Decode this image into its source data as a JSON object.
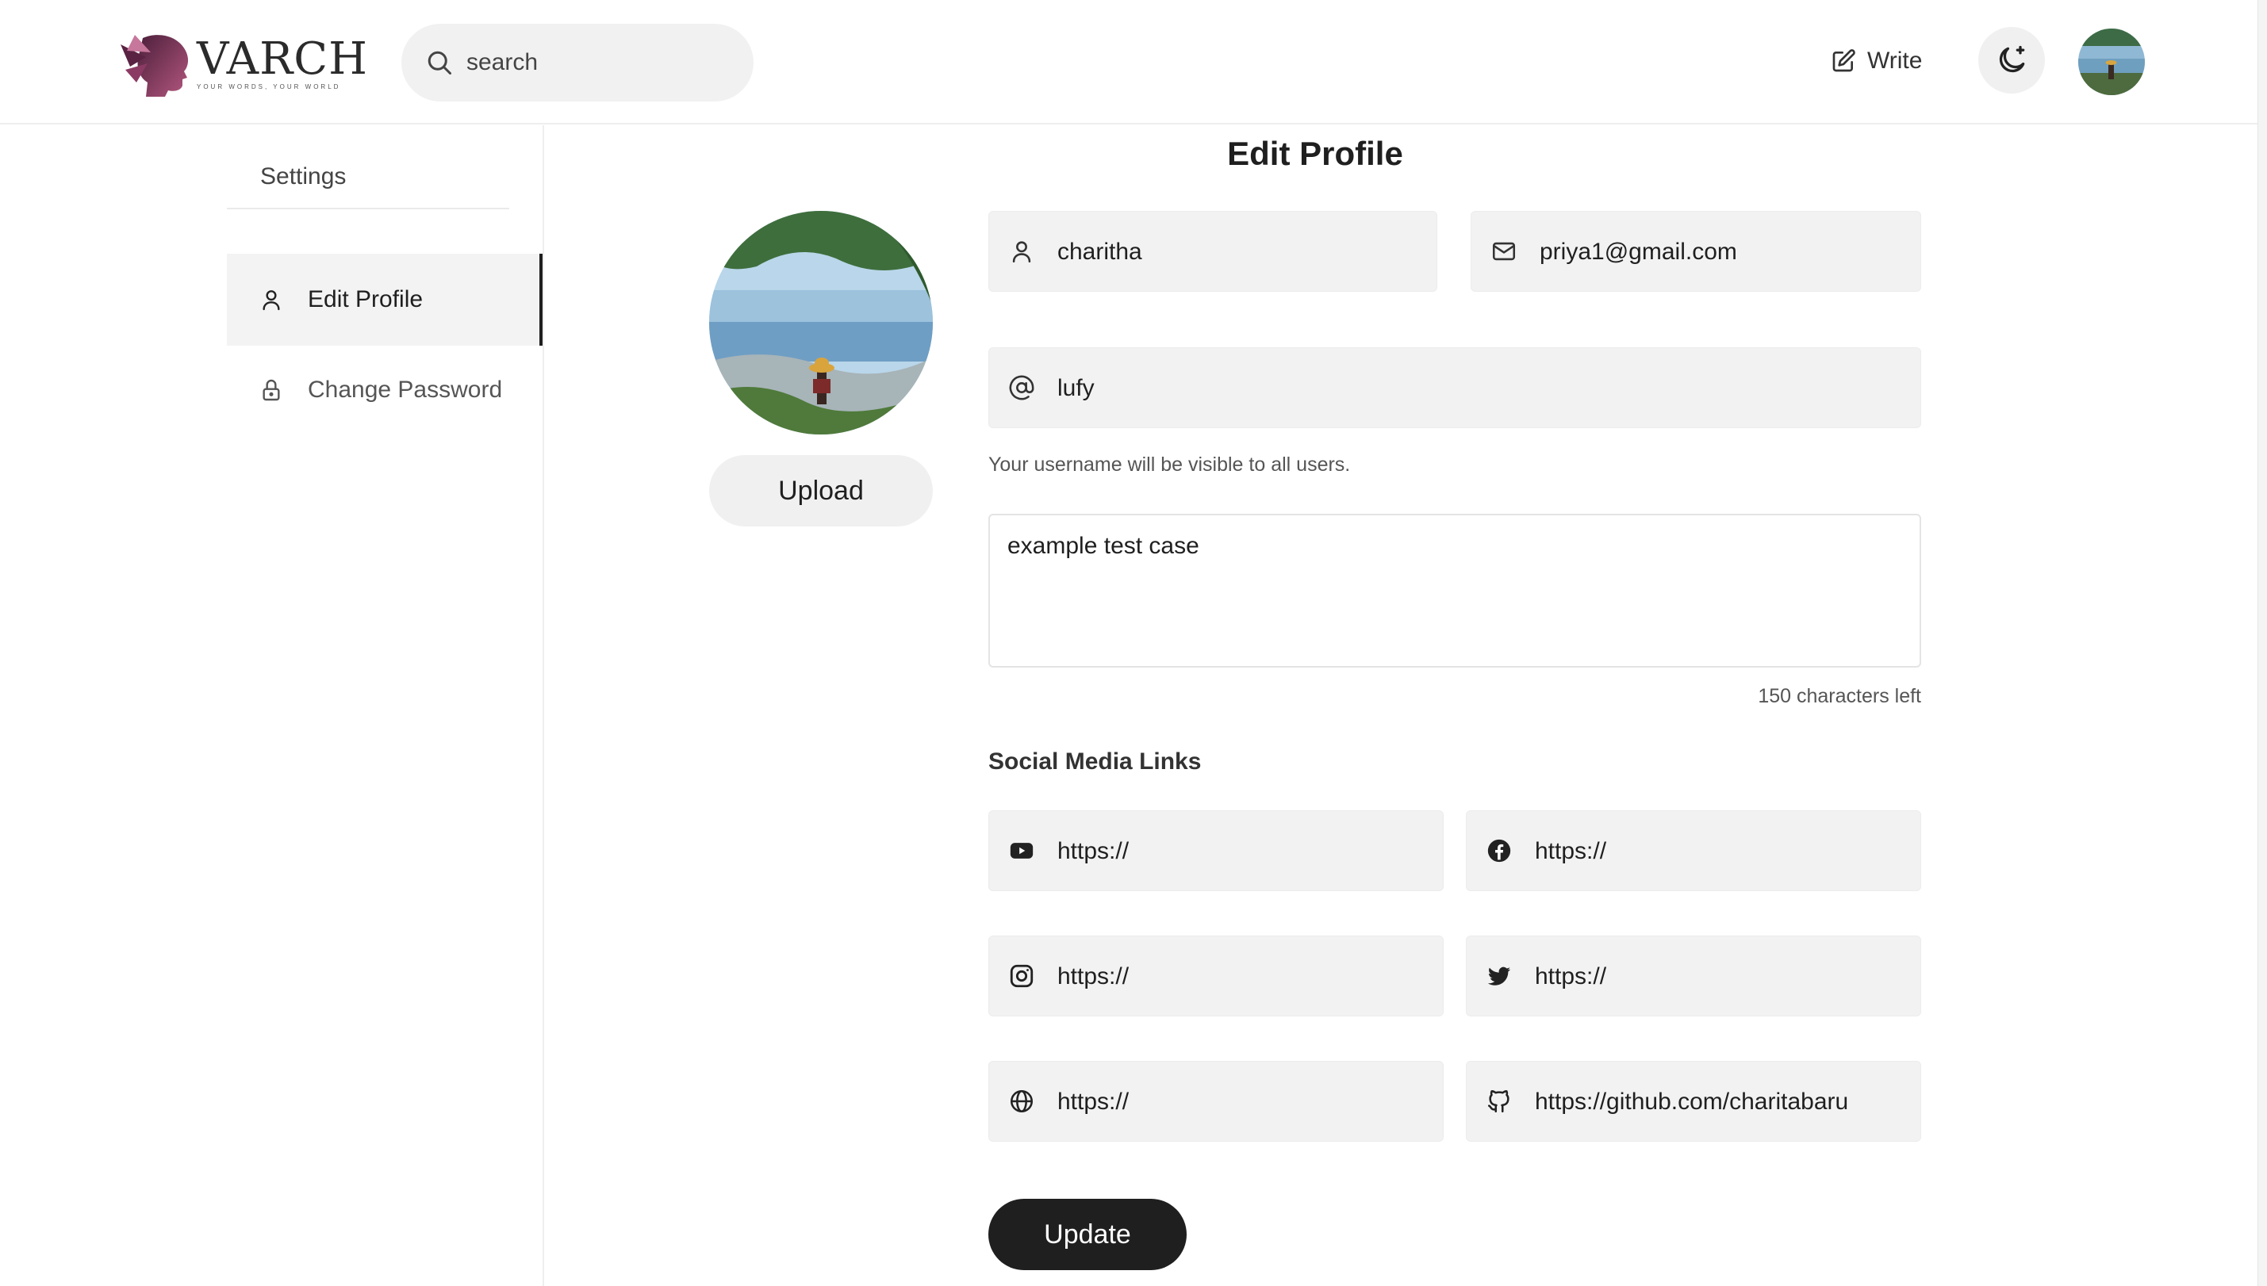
{
  "header": {
    "logo_text": "VARCH",
    "logo_tagline": "YOUR WORDS, YOUR WORLD",
    "search_placeholder": "search",
    "write_label": "Write"
  },
  "sidebar": {
    "title": "Settings",
    "items": [
      {
        "label": "Edit Profile",
        "icon": "user-icon",
        "active": true
      },
      {
        "label": "Change Password",
        "icon": "lock-icon",
        "active": false
      }
    ]
  },
  "main": {
    "title": "Edit Profile",
    "upload_label": "Upload",
    "fullname": "charitha",
    "email": "priya1@gmail.com",
    "username": "lufy",
    "username_hint": "Your username will be visible to all users.",
    "bio": "example test case",
    "chars_left": "150 characters left",
    "social_title": "Social Media Links",
    "social": {
      "youtube": "https://",
      "facebook": "https://",
      "instagram": "https://",
      "twitter": "https://",
      "website": "https://",
      "github": "https://github.com/charitabaru"
    },
    "update_label": "Update"
  },
  "colors": {
    "accent_dark": "#1f1f1f",
    "field_bg": "#f2f2f2",
    "logo_purple": "#7a2e55"
  }
}
